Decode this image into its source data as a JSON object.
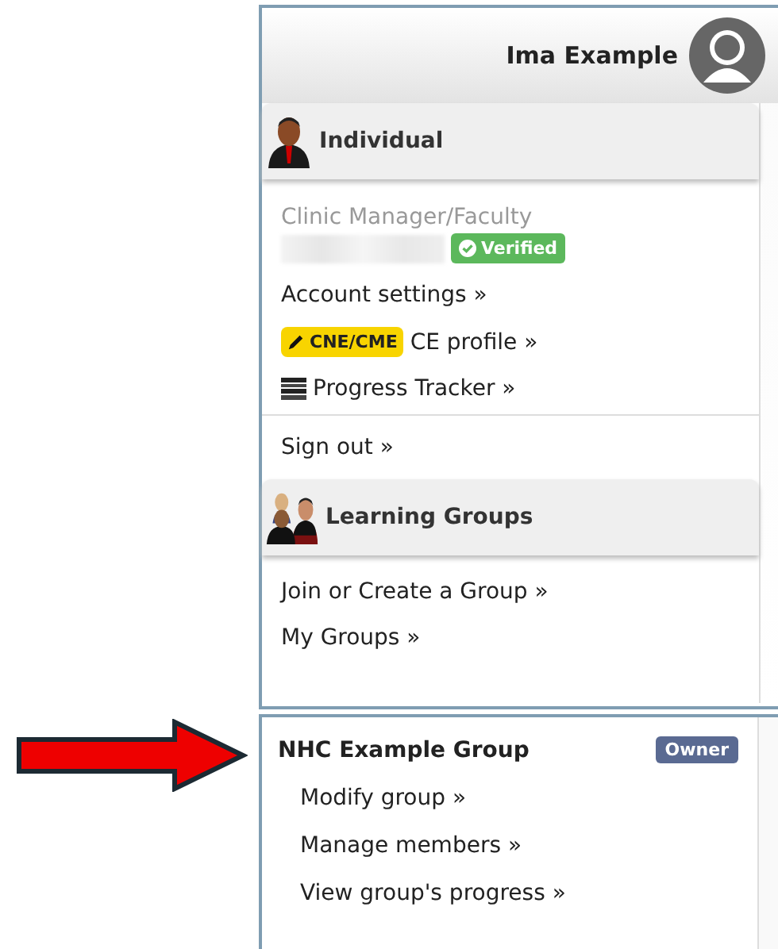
{
  "user": {
    "name": "Ima Example"
  },
  "individual": {
    "title": "Individual",
    "role": "Clinic Manager/Faculty",
    "verified_badge": "Verified",
    "links": [
      {
        "kind": "plain",
        "label": "Account settings »"
      },
      {
        "kind": "badge",
        "badge": "CNE/CME",
        "label": "CE profile »"
      },
      {
        "kind": "tracker",
        "label": "Progress Tracker »"
      }
    ],
    "sign_out": "Sign out »"
  },
  "learning_groups": {
    "title": "Learning Groups",
    "links": [
      "Join or Create a Group »",
      "My Groups »"
    ]
  },
  "group": {
    "name": "NHC Example Group",
    "role_badge": "Owner",
    "links": [
      "Modify group »",
      "Manage members »",
      "View group's progress »"
    ]
  }
}
